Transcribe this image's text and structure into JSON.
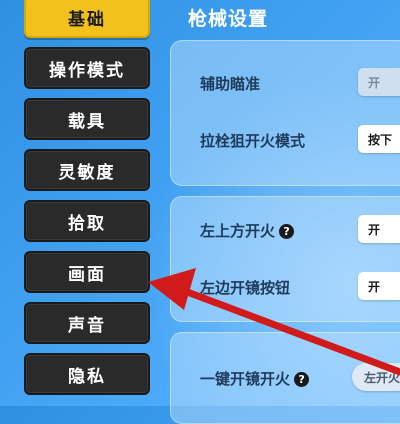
{
  "sidebar": {
    "items": [
      {
        "label": "基础",
        "active": true
      },
      {
        "label": "操作模式"
      },
      {
        "label": "载具"
      },
      {
        "label": "灵敏度"
      },
      {
        "label": "拾取"
      },
      {
        "label": "画面"
      },
      {
        "label": "声音"
      },
      {
        "label": "隐私"
      }
    ]
  },
  "main": {
    "title": "枪械设置",
    "rows": [
      {
        "label": "辅助瞄准",
        "value": "开"
      },
      {
        "label": "拉栓狙开火模式",
        "value": "按下"
      },
      {
        "label": "左上方开火",
        "value": "开"
      },
      {
        "label": "左边开镜按钮",
        "value": "开"
      },
      {
        "label": "一键开镜开火",
        "value": "左开火"
      }
    ]
  },
  "colors": {
    "accent": "#f2c21c",
    "arrow": "#d11a1a",
    "nav_bg": "#2a2a2a"
  }
}
